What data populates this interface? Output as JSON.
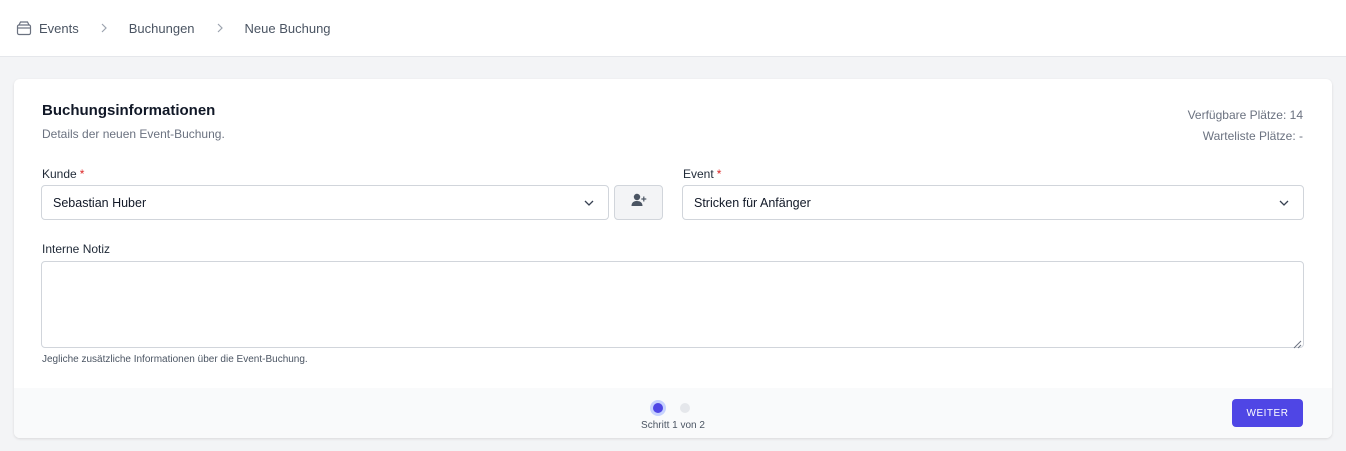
{
  "breadcrumb": {
    "items": [
      "Events",
      "Buchungen",
      "Neue Buchung"
    ]
  },
  "card": {
    "title": "Buchungsinformationen",
    "subtitle": "Details der neuen Event-Buchung.",
    "stats": {
      "available": "Verfügbare Plätze: 14",
      "waitlist": "Warteliste Plätze: -"
    }
  },
  "form": {
    "customer": {
      "label": "Kunde",
      "required_mark": "*",
      "value": "Sebastian Huber"
    },
    "event": {
      "label": "Event",
      "required_mark": "*",
      "value": "Stricken für Anfänger"
    },
    "note": {
      "label": "Interne Notiz",
      "value": "",
      "helper": "Jegliche zusätzliche Informationen über die Event-Buchung."
    }
  },
  "stepper": {
    "text": "Schritt 1 von 2",
    "current": 1,
    "total": 2
  },
  "buttons": {
    "next": "WEITER"
  },
  "colors": {
    "accent": "#4f46e5",
    "required": "#dc2626"
  },
  "icons": {
    "breadcrumb_home": "archive-box-icon",
    "separator": "chevron-right-icon",
    "select_chevron": "chevron-down-icon",
    "add_customer": "user-plus-icon"
  }
}
